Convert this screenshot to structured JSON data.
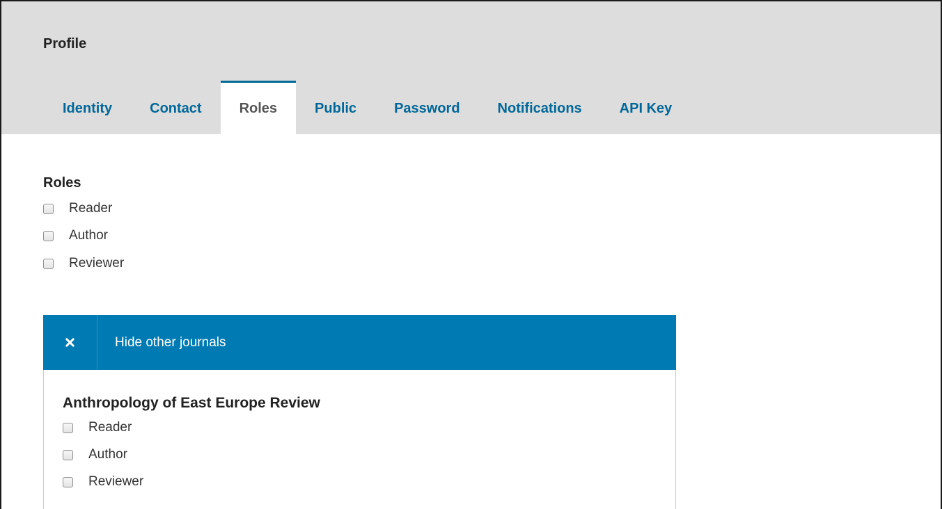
{
  "header": {
    "title": "Profile"
  },
  "tabs": [
    {
      "label": "Identity",
      "active": false
    },
    {
      "label": "Contact",
      "active": false
    },
    {
      "label": "Roles",
      "active": true
    },
    {
      "label": "Public",
      "active": false
    },
    {
      "label": "Password",
      "active": false
    },
    {
      "label": "Notifications",
      "active": false
    },
    {
      "label": "API Key",
      "active": false
    }
  ],
  "roles_section": {
    "heading": "Roles",
    "options": [
      {
        "label": "Reader",
        "checked": false
      },
      {
        "label": "Author",
        "checked": false
      },
      {
        "label": "Reviewer",
        "checked": false
      }
    ]
  },
  "other_journals": {
    "toggle_label": "Hide other journals",
    "toggle_icon": "close-icon",
    "journals": [
      {
        "title": "Anthropology of East Europe Review",
        "options": [
          {
            "label": "Reader",
            "checked": false
          },
          {
            "label": "Author",
            "checked": false
          },
          {
            "label": "Reviewer",
            "checked": false
          }
        ]
      }
    ]
  },
  "colors": {
    "header_bg": "#dddddd",
    "link_blue": "#006798",
    "panel_bar": "#007ab2"
  }
}
